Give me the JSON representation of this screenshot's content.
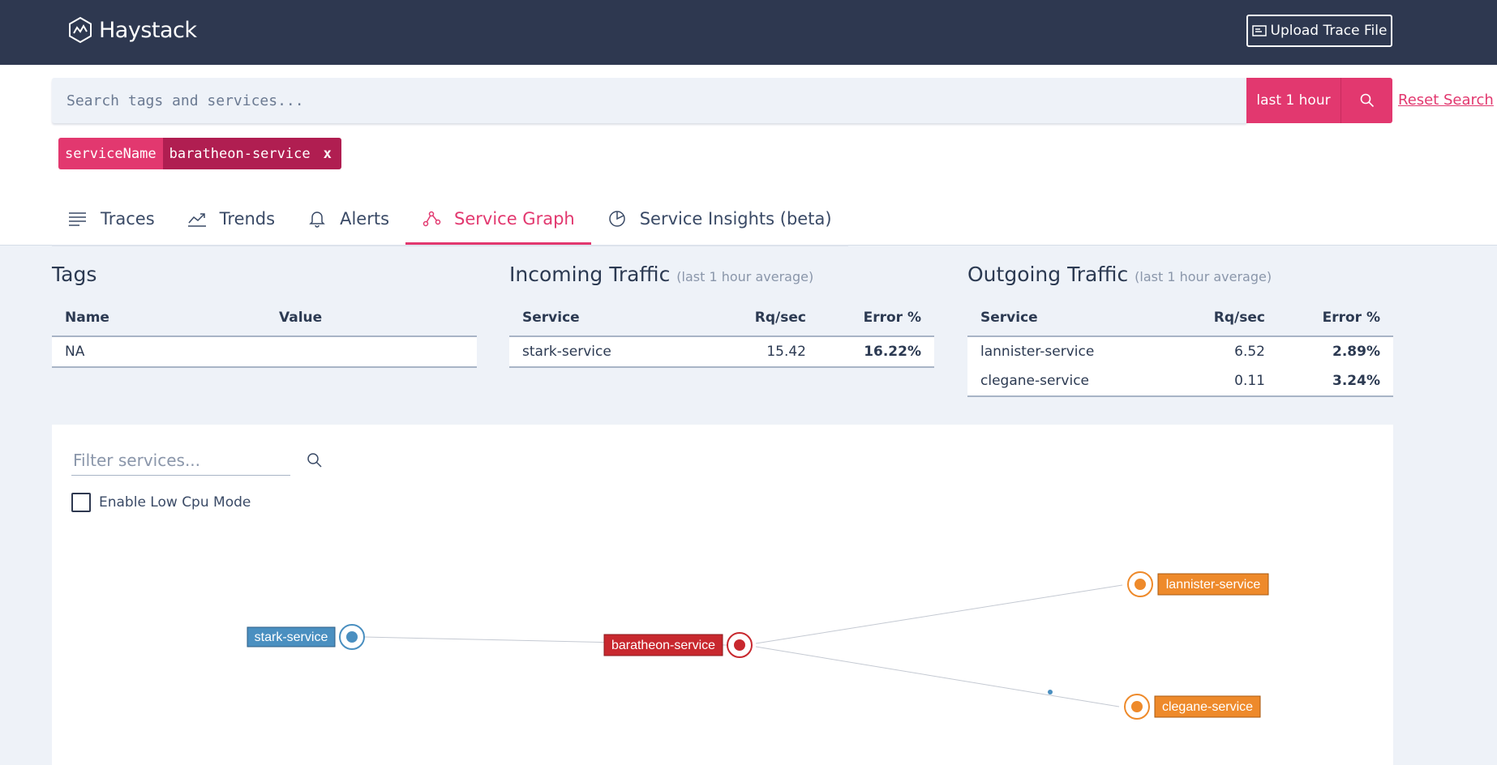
{
  "header": {
    "app_name": "Haystack",
    "upload_label": "Upload Trace File"
  },
  "search": {
    "placeholder": "Search tags and services...",
    "time_range": "last 1 hour",
    "reset_label": "Reset Search",
    "chip": {
      "key": "serviceName",
      "value": "baratheon-service",
      "remove": "x"
    }
  },
  "tabs": [
    {
      "label": "Traces",
      "icon": "list-icon"
    },
    {
      "label": "Trends",
      "icon": "trend-chart-icon"
    },
    {
      "label": "Alerts",
      "icon": "bell-icon"
    },
    {
      "label": "Service Graph",
      "icon": "graph-icon",
      "active": true
    },
    {
      "label": "Service Insights (beta)",
      "icon": "pie-chart-icon"
    }
  ],
  "tags_panel": {
    "title": "Tags",
    "columns": [
      "Name",
      "Value"
    ],
    "rows": [
      [
        "NA",
        ""
      ]
    ]
  },
  "incoming_panel": {
    "title": "Incoming Traffic",
    "subtitle": "(last 1 hour average)",
    "columns": [
      "Service",
      "Rq/sec",
      "Error %"
    ],
    "rows": [
      [
        "stark-service",
        "15.42",
        "16.22%"
      ]
    ]
  },
  "outgoing_panel": {
    "title": "Outgoing Traffic",
    "subtitle": "(last 1 hour average)",
    "columns": [
      "Service",
      "Rq/sec",
      "Error %"
    ],
    "rows": [
      [
        "lannister-service",
        "6.52",
        "2.89%"
      ],
      [
        "clegane-service",
        "0.11",
        "3.24%"
      ]
    ]
  },
  "graph": {
    "filter_placeholder": "Filter services...",
    "low_cpu_label": "Enable Low Cpu Mode",
    "low_cpu_checked": false,
    "nodes": [
      {
        "name": "stark-service",
        "status": "normal",
        "color": "#4a8fc0"
      },
      {
        "name": "baratheon-service",
        "status": "error",
        "color": "#c8282e"
      },
      {
        "name": "lannister-service",
        "status": "warning",
        "color": "#ee8a2b"
      },
      {
        "name": "clegane-service",
        "status": "warning",
        "color": "#ee8a2b"
      }
    ],
    "edges": [
      {
        "from": "stark-service",
        "to": "baratheon-service"
      },
      {
        "from": "baratheon-service",
        "to": "lannister-service"
      },
      {
        "from": "baratheon-service",
        "to": "clegane-service"
      }
    ]
  },
  "colors": {
    "accent": "#e2386f",
    "accent_dark": "#b01e51",
    "topbar": "#2e3850",
    "error_red": "#c8282e",
    "warning_orange": "#ee8a2b",
    "normal_blue": "#4a8fc0"
  }
}
